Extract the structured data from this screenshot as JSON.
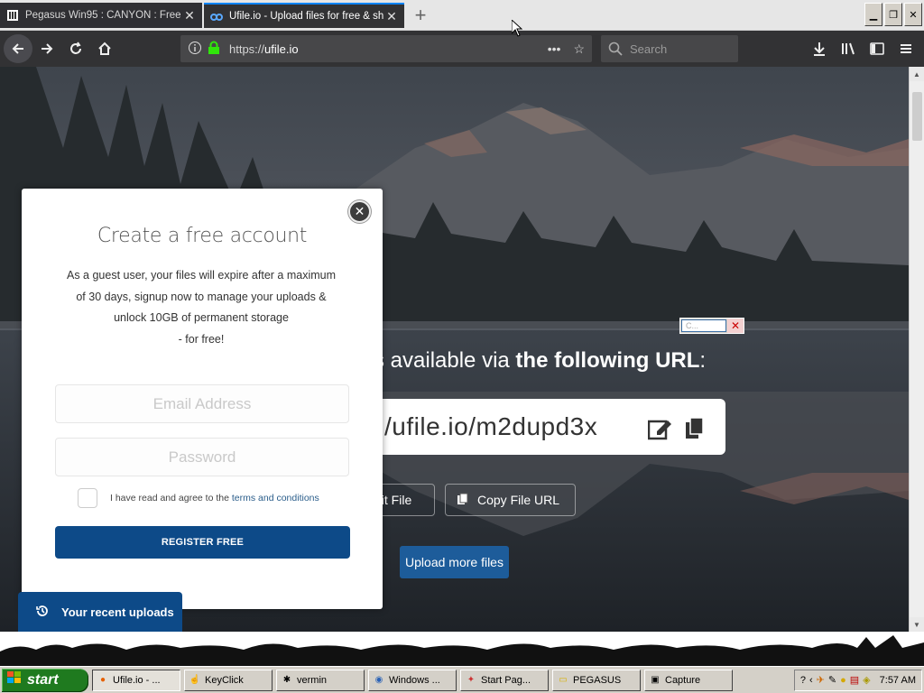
{
  "browser": {
    "tabs": [
      {
        "title": "Pegasus Win95 : CANYON : Free",
        "state": "inactive"
      },
      {
        "title": "Ufile.io - Upload files for free & sh",
        "state": "active"
      }
    ],
    "url_prefix": "https://",
    "url_domain": "ufile.io",
    "search_placeholder": "Search"
  },
  "page": {
    "headline_prefix": "s available via ",
    "headline_bold": "the following URL",
    "headline_suffix": ":",
    "file_url": "/ufile.io/m2dupd3x",
    "edit_button_label": "dit File",
    "copy_button_label": "Copy File URL",
    "upload_more_label": "Upload more files",
    "recent_uploads_label": "Your recent uploads",
    "mini_popup_title": "C..."
  },
  "modal": {
    "title": "Create a free account",
    "desc_line1": "As a guest user, your files will expire after a maximum",
    "desc_line2": "of 30 days, signup now to manage your uploads &",
    "desc_line3": "unlock 10GB of permanent storage",
    "desc_line4": "- for free!",
    "email_placeholder": "Email Address",
    "password_placeholder": "Password",
    "terms_prefix": "I have read and agree to the ",
    "terms_link": "terms and conditions",
    "register_label": "REGISTER FREE"
  },
  "taskbar": {
    "start_label": "start",
    "items": [
      {
        "label": "Ufile.io - ...",
        "icon": "firefox-icon",
        "pressed": true
      },
      {
        "label": "KeyClick",
        "icon": "pointer-icon",
        "pressed": false
      },
      {
        "label": "vermin",
        "icon": "bug-icon",
        "pressed": false
      },
      {
        "label": "Windows ...",
        "icon": "windows-icon",
        "pressed": false
      },
      {
        "label": "Start Pag...",
        "icon": "start-page-icon",
        "pressed": false
      },
      {
        "label": "PEGASUS",
        "icon": "folder-icon",
        "pressed": false
      },
      {
        "label": "Capture",
        "icon": "capture-icon",
        "pressed": false
      }
    ],
    "clock": "7:57 AM"
  },
  "colors": {
    "brand_blue": "#0d4a88",
    "button_blue": "#1d5c9a",
    "firefox_dark": "#323234",
    "active_tab_accent": "#0a84ff",
    "taskbar_gray": "#d4d0c8",
    "start_green": "#1f7a1f"
  }
}
